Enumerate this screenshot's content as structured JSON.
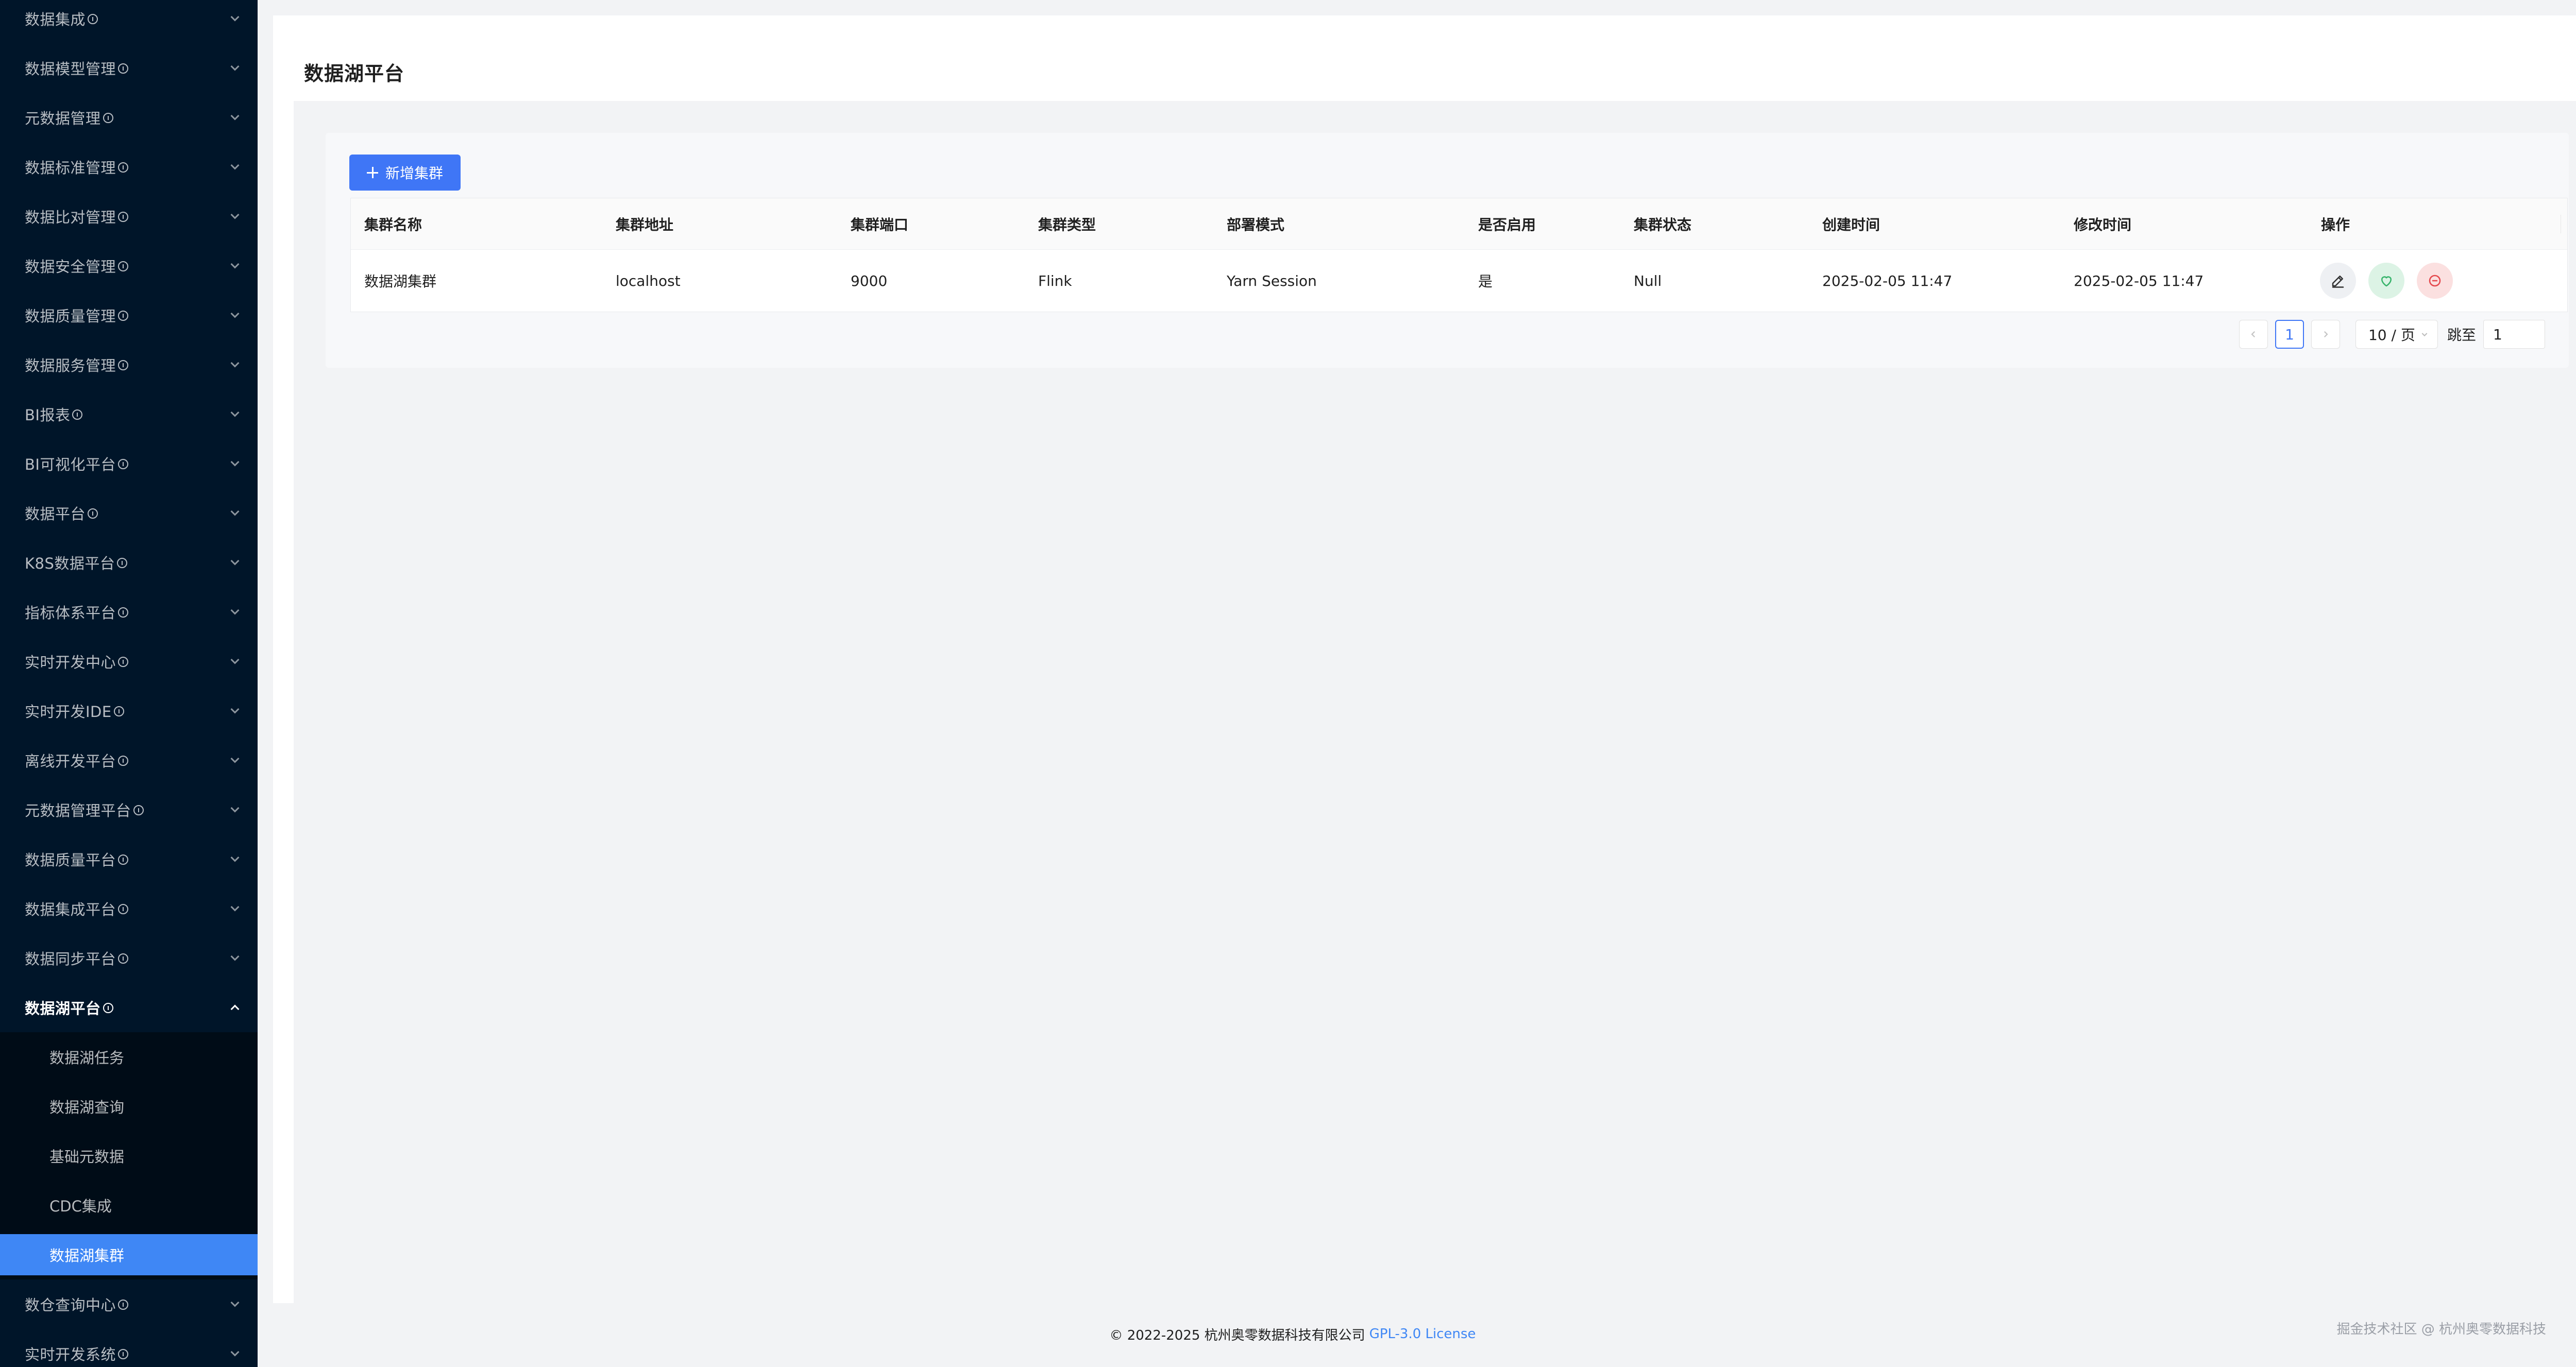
{
  "sidebar": {
    "items": [
      {
        "label": "数据集成"
      },
      {
        "label": "数据模型管理"
      },
      {
        "label": "元数据管理"
      },
      {
        "label": "数据标准管理"
      },
      {
        "label": "数据比对管理"
      },
      {
        "label": "数据安全管理"
      },
      {
        "label": "数据质量管理"
      },
      {
        "label": "数据服务管理"
      },
      {
        "label": "BI报表"
      },
      {
        "label": "BI可视化平台"
      },
      {
        "label": "数据平台"
      },
      {
        "label": "K8S数据平台"
      },
      {
        "label": "指标体系平台"
      },
      {
        "label": "实时开发中心"
      },
      {
        "label": "实时开发IDE"
      },
      {
        "label": "离线开发平台"
      },
      {
        "label": "元数据管理平台"
      },
      {
        "label": "数据质量平台"
      },
      {
        "label": "数据集成平台"
      },
      {
        "label": "数据同步平台"
      },
      {
        "label": "数据湖平台"
      }
    ],
    "submenu": [
      {
        "label": "数据湖任务"
      },
      {
        "label": "数据湖查询"
      },
      {
        "label": "基础元数据"
      },
      {
        "label": "CDC集成"
      },
      {
        "label": "数据湖集群"
      }
    ],
    "after_items": [
      {
        "label": "数仓查询中心"
      },
      {
        "label": "实时开发系统"
      }
    ],
    "active_submenu": "数据湖集群"
  },
  "page": {
    "title": "数据湖平台",
    "add_button_label": "新增集群"
  },
  "table": {
    "columns": [
      "集群名称",
      "集群地址",
      "集群端口",
      "集群类型",
      "部署模式",
      "是否启用",
      "集群状态",
      "创建时间",
      "修改时间",
      "操作"
    ],
    "rows": [
      [
        "数据湖集群",
        "localhost",
        "9000",
        "Flink",
        "Yarn Session",
        "是",
        "Null",
        "2025-02-05 11:47",
        "2025-02-05 11:47"
      ]
    ],
    "actions": [
      "edit-icon",
      "heart-icon",
      "minus-circle-icon"
    ]
  },
  "pagination": {
    "current_page": "1",
    "page_size_label": "10 / 页",
    "jump_label": "跳至",
    "jump_value": "1"
  },
  "footer": {
    "copyright": "© 2022-2025 杭州奥零数据科技有限公司",
    "license_link": "GPL-3.0 License",
    "watermark": "掘金技术社区 @ 杭州奥零数据科技"
  },
  "colors": {
    "sidebar_bg": "#001529",
    "submenu_bg": "#000c17",
    "active_item": "#3f87f5",
    "primary_button": "#3f76f6"
  }
}
